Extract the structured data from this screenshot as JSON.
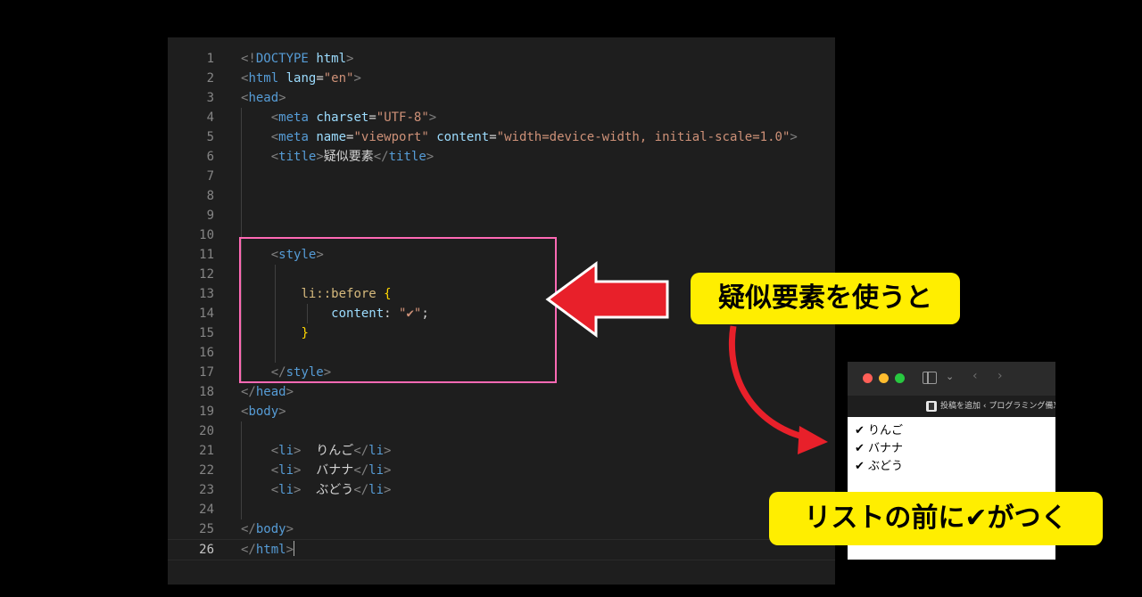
{
  "editor": {
    "lines": [
      {
        "n": "1",
        "tokens": [
          [
            "br",
            "<!"
          ],
          [
            "tag",
            "DOCTYPE"
          ],
          [
            "txt",
            " "
          ],
          [
            "attr",
            "html"
          ],
          [
            "br",
            ">"
          ]
        ]
      },
      {
        "n": "2",
        "tokens": [
          [
            "br",
            "<"
          ],
          [
            "tag",
            "html"
          ],
          [
            "txt",
            " "
          ],
          [
            "attr",
            "lang"
          ],
          [
            "txt",
            "="
          ],
          [
            "str",
            "\"en\""
          ],
          [
            "br",
            ">"
          ]
        ]
      },
      {
        "n": "3",
        "tokens": [
          [
            "br",
            "<"
          ],
          [
            "tag",
            "head"
          ],
          [
            "br",
            ">"
          ]
        ]
      },
      {
        "n": "4",
        "tokens": [
          [
            "txt",
            "    "
          ],
          [
            "br",
            "<"
          ],
          [
            "tag",
            "meta"
          ],
          [
            "txt",
            " "
          ],
          [
            "attr",
            "charset"
          ],
          [
            "txt",
            "="
          ],
          [
            "str",
            "\"UTF-8\""
          ],
          [
            "br",
            ">"
          ]
        ]
      },
      {
        "n": "5",
        "tokens": [
          [
            "txt",
            "    "
          ],
          [
            "br",
            "<"
          ],
          [
            "tag",
            "meta"
          ],
          [
            "txt",
            " "
          ],
          [
            "attr",
            "name"
          ],
          [
            "txt",
            "="
          ],
          [
            "str",
            "\"viewport\""
          ],
          [
            "txt",
            " "
          ],
          [
            "attr",
            "content"
          ],
          [
            "txt",
            "="
          ],
          [
            "str",
            "\"width=device-width, initial-scale=1.0\""
          ],
          [
            "br",
            ">"
          ]
        ]
      },
      {
        "n": "6",
        "tokens": [
          [
            "txt",
            "    "
          ],
          [
            "br",
            "<"
          ],
          [
            "tag",
            "title"
          ],
          [
            "br",
            ">"
          ],
          [
            "txt",
            "疑似要素"
          ],
          [
            "br",
            "</"
          ],
          [
            "tag",
            "title"
          ],
          [
            "br",
            ">"
          ]
        ]
      },
      {
        "n": "7",
        "tokens": []
      },
      {
        "n": "8",
        "tokens": []
      },
      {
        "n": "9",
        "tokens": []
      },
      {
        "n": "10",
        "tokens": []
      },
      {
        "n": "11",
        "tokens": [
          [
            "txt",
            "    "
          ],
          [
            "br",
            "<"
          ],
          [
            "tag",
            "style"
          ],
          [
            "br",
            ">"
          ]
        ]
      },
      {
        "n": "12",
        "tokens": []
      },
      {
        "n": "13",
        "tokens": [
          [
            "txt",
            "        "
          ],
          [
            "sel",
            "li::before"
          ],
          [
            "txt",
            " "
          ],
          [
            "brace",
            "{"
          ]
        ]
      },
      {
        "n": "14",
        "tokens": [
          [
            "txt",
            "            "
          ],
          [
            "prop",
            "content"
          ],
          [
            "punc",
            ": "
          ],
          [
            "str",
            "\"✔\""
          ],
          [
            "punc",
            ";"
          ]
        ]
      },
      {
        "n": "15",
        "tokens": [
          [
            "txt",
            "        "
          ],
          [
            "brace",
            "}"
          ]
        ]
      },
      {
        "n": "16",
        "tokens": []
      },
      {
        "n": "17",
        "tokens": [
          [
            "txt",
            "    "
          ],
          [
            "br",
            "</"
          ],
          [
            "tag",
            "style"
          ],
          [
            "br",
            ">"
          ]
        ]
      },
      {
        "n": "18",
        "tokens": [
          [
            "br",
            "</"
          ],
          [
            "tag",
            "head"
          ],
          [
            "br",
            ">"
          ]
        ]
      },
      {
        "n": "19",
        "tokens": [
          [
            "br",
            "<"
          ],
          [
            "tag",
            "body"
          ],
          [
            "br",
            ">"
          ]
        ]
      },
      {
        "n": "20",
        "tokens": []
      },
      {
        "n": "21",
        "tokens": [
          [
            "txt",
            "    "
          ],
          [
            "br",
            "<"
          ],
          [
            "tag",
            "li"
          ],
          [
            "br",
            ">"
          ],
          [
            "txt",
            "  りんご"
          ],
          [
            "br",
            "</"
          ],
          [
            "tag",
            "li"
          ],
          [
            "br",
            ">"
          ]
        ]
      },
      {
        "n": "22",
        "tokens": [
          [
            "txt",
            "    "
          ],
          [
            "br",
            "<"
          ],
          [
            "tag",
            "li"
          ],
          [
            "br",
            ">"
          ],
          [
            "txt",
            "  バナナ"
          ],
          [
            "br",
            "</"
          ],
          [
            "tag",
            "li"
          ],
          [
            "br",
            ">"
          ]
        ]
      },
      {
        "n": "23",
        "tokens": [
          [
            "txt",
            "    "
          ],
          [
            "br",
            "<"
          ],
          [
            "tag",
            "li"
          ],
          [
            "br",
            ">"
          ],
          [
            "txt",
            "  ぶどう"
          ],
          [
            "br",
            "</"
          ],
          [
            "tag",
            "li"
          ],
          [
            "br",
            ">"
          ]
        ]
      },
      {
        "n": "24",
        "tokens": []
      },
      {
        "n": "25",
        "tokens": [
          [
            "br",
            "</"
          ],
          [
            "tag",
            "body"
          ],
          [
            "br",
            ">"
          ]
        ]
      },
      {
        "n": "26",
        "tokens": [
          [
            "br",
            "</"
          ],
          [
            "tag",
            "html"
          ],
          [
            "br",
            ">"
          ]
        ]
      }
    ],
    "active_line": "26"
  },
  "annotations": {
    "callout_top": "疑似要素を使うと",
    "callout_bottom": "リストの前に✔がつく"
  },
  "browser": {
    "tab_title": "投稿を追加 ‹ プログラミング備忘",
    "back_glyph": "‹",
    "forward_glyph": "›",
    "dropdown_glyph": "⌄",
    "items": [
      "✔ りんご",
      "✔ バナナ",
      "✔ ぶどう"
    ]
  },
  "colors": {
    "editor_bg": "#1e1e1e",
    "highlight_box": "#ff69b4",
    "callout_bg": "#ffee00",
    "arrow_red": "#e8202a"
  }
}
